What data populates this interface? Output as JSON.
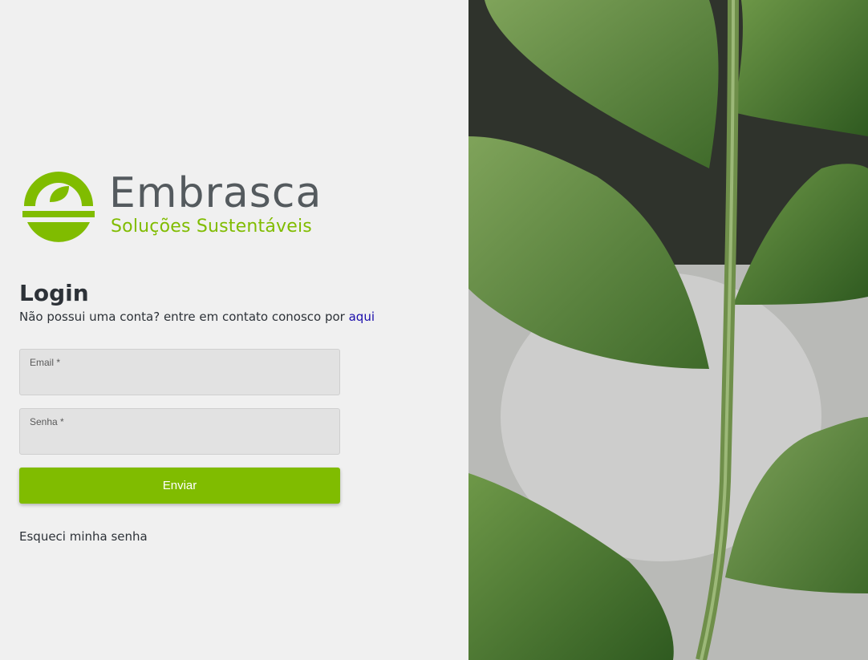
{
  "brand": {
    "name": "Embrasca",
    "tagline": "Soluções Sustentáveis",
    "primary_color": "#80bc00",
    "text_color": "#545a5e"
  },
  "login": {
    "title": "Login",
    "subtitle_prefix": "Não possui uma conta? entre em contato conosco por",
    "subtitle_link": "aqui",
    "email_label": "Email *",
    "email_value": "",
    "password_label": "Senha *",
    "password_value": "",
    "submit_label": "Enviar",
    "forgot_label": "Esqueci minha senha"
  },
  "background_image": {
    "subject": "green fern leaves photo"
  }
}
